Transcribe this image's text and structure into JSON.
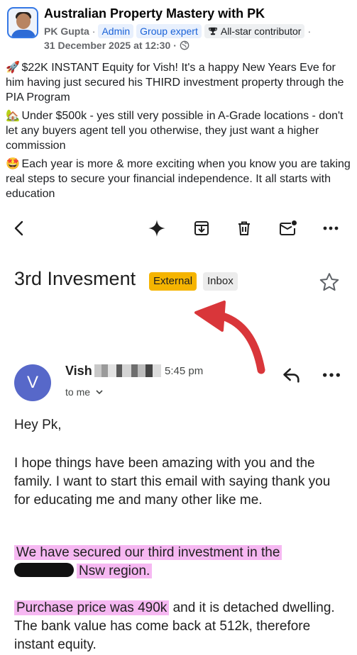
{
  "post": {
    "group_name": "Australian Property Mastery with PK",
    "author": "PK Gupta",
    "separator": "·",
    "badges": [
      "Admin",
      "Group expert"
    ],
    "contributor_badge": "All-star contributor",
    "date": "31 December 2025 at 12:30",
    "date_separator": "·",
    "audience_icon": "globe-icon",
    "paragraphs": [
      {
        "emoji": "🚀",
        "text": "$22K INSTANT Equity for Vish! It's a happy New Years Eve for him having just secured his THIRD investment property through the PIA Program"
      },
      {
        "emoji": "🏡",
        "text": "Under $500k - yes still very possible in A-Grade locations - don't let any buyers agent tell you otherwise, they just want a higher commission"
      },
      {
        "emoji": "🤩",
        "text": "Each year is more & more exciting when you know you are taking real steps to secure your financial independence. It all starts with education"
      }
    ]
  },
  "toolbar": {
    "icons": [
      "back-arrow-icon",
      "gemini-sparkle-icon",
      "archive-icon",
      "delete-icon",
      "mark-unread-icon",
      "more-options-icon"
    ]
  },
  "email": {
    "subject": "3rd Invesment",
    "labels": {
      "external": "External",
      "inbox": "Inbox"
    },
    "sender_initial": "V",
    "sender_name_visible": "Vish",
    "time": "5:45 pm",
    "to": "to me",
    "greeting": "Hey Pk,",
    "paragraph1": "I hope things have been amazing with you and the family. I want to start this email with saying thank you for educating me and many other like me.",
    "paragraph2_line1": "We have secured our third investment in the",
    "paragraph2_line2": "Nsw region.",
    "paragraph3_highlight": "Purchase price was 490k",
    "paragraph3_rest": "and it is detached dwelling. The bank value has come back at 512k, therefore instant equity."
  },
  "colors": {
    "external_label": "#f5b400",
    "inbox_label": "#ececec",
    "avatar": "#5768c9",
    "highlight": "#f6b8f2",
    "annotation_arrow": "#d9363a",
    "badge_blue": "#1b63d8"
  }
}
